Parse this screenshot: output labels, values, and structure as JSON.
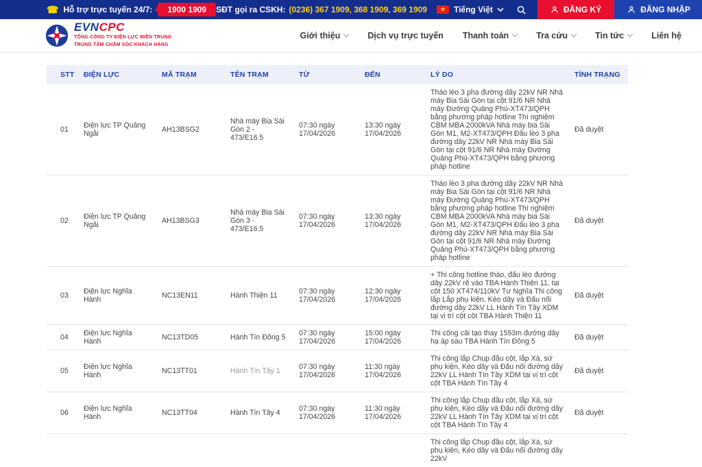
{
  "topbar": {
    "support_label": "Hỗ trợ trực tuyến 24/7:",
    "hotline_badge": "1900 1909",
    "cskh_label": "SĐT gọi ra CSKH:",
    "cskh_numbers": "(0236) 367 1909, 368 1909, 369 1909",
    "language": "Tiếng Việt",
    "register_label": "ĐĂNG KÝ",
    "login_label": "ĐĂNG NHẬP"
  },
  "header": {
    "logo_text_evn": "EVN",
    "logo_text_cpc": "CPC",
    "logo_sub1": "TỔNG CÔNG TY ĐIỆN LỰC MIỀN TRUNG",
    "logo_sub2": "TRUNG TÂM CHĂM SÓC KHÁCH HÀNG",
    "nav": [
      {
        "label": "Giới thiệu",
        "has_dropdown": true
      },
      {
        "label": "Dịch vụ trực tuyến",
        "has_dropdown": false
      },
      {
        "label": "Thanh toán",
        "has_dropdown": true
      },
      {
        "label": "Tra cứu",
        "has_dropdown": true
      },
      {
        "label": "Tin tức",
        "has_dropdown": true
      },
      {
        "label": "Liên hệ",
        "has_dropdown": false
      }
    ]
  },
  "icons": {
    "phone": "phone-icon",
    "flag": "vietnam-flag-icon",
    "search": "search-icon",
    "user": "user-icon",
    "chevron": "chevron-down-icon",
    "logo": "evn-star-logo"
  },
  "colors": {
    "bar_navy": "#142e8e",
    "login_blue": "#1e42ae",
    "accent_red": "#e8102e",
    "accent_yellow": "#ffd400",
    "table_header_text": "#1f41ad",
    "table_header_bg": "#edf0f8"
  },
  "table": {
    "headers": [
      "STT",
      "ĐIỆN LỰC",
      "MÃ TRẠM",
      "TÊN TRẠM",
      "TỪ",
      "ĐẾN",
      "LÝ DO",
      "TÌNH TRẠNG"
    ],
    "rows": [
      {
        "stt": "01",
        "dien_luc": "Điện lực TP Quảng Ngãi",
        "ma_tram": "AH13BSG2",
        "ten_tram": "Nhà máy Bia Sài Gòn 2 - 473/E16.5",
        "tu": "07:30 ngày\n17/04/2026",
        "den": "13:30 ngày\n17/04/2026",
        "ly_do": "Tháo lèo 3 pha đường dây 22kV NR Nhà máy Bia Sài Gòn tại cột 91/6 NR Nhà máy Đường Quảng Phú-XT473/QPH bằng phương pháp hotline Thí nghiệm CBM MBA 2000kVA Nhà máy bia Sài Gòn M1, M2-XT473/QPH Đấu lèo 3 pha đường dây 22kV NR Nhà máy Bia Sài Gòn tại cột 91/6 NR Nhà máy Đường Quảng Phú-XT473/QPH bằng phương pháp hotline",
        "tinh_trang": "Đã duyệt"
      },
      {
        "stt": "02",
        "dien_luc": "Điện lực TP Quảng Ngãi",
        "ma_tram": "AH13BSG3",
        "ten_tram": "Nhà máy Bia Sài Gòn 3 - 473/E16.5",
        "tu": "07:30 ngày\n17/04/2026",
        "den": "13:30 ngày\n17/04/2026",
        "ly_do": "Tháo lèo 3 pha đường dây 22kV NR Nhà máy Bia Sài Gòn tại cột 91/6 NR Nhà máy Đường Quảng Phú-XT473/QPH bằng phương pháp hotline Thí nghiệm CBM MBA 2000kVA Nhà máy bia Sài Gòn M1, M2-XT473/QPH Đấu lèo 3 pha đường dây 22kV NR Nhà máy Bia Sài Gòn tại cột 91/6 NR Nhà máy Đường Quảng Phú-XT473/QPH bằng phương pháp hotline",
        "tinh_trang": "Đã duyệt"
      },
      {
        "stt": "03",
        "dien_luc": "Điện lực Nghĩa Hành",
        "ma_tram": "NC13EN11",
        "ten_tram": "Hành Thiện 11",
        "tu": "07:30 ngày\n17/04/2026",
        "den": "12:30 ngày\n17/04/2026",
        "ly_do": "+ Thi công hotline tháo, đấu lèo đường dây 22kV rẽ vào TBA Hành Thiện 11, tại cột 150 XT474/110kV Tư Nghĩa Thi công lắp Lắp phụ kiện, Kéo dây và Đấu nối đường dây 22kV LL Hành Tín Tây XDM tại vị trí cột cột TBA Hành Thiện 11",
        "tinh_trang": "Đã duyệt"
      },
      {
        "stt": "04",
        "dien_luc": "Điện lực Nghĩa Hành",
        "ma_tram": "NC13TD05",
        "ten_tram": "Hành Tín Đông 5",
        "tu": "07:30 ngày\n17/04/2026",
        "den": "15:00 ngày\n17/04/2026",
        "ly_do": "Thi công cải tạo thay 1553m đường dây hạ áp sau TBA Hành Tín Đông 5",
        "tinh_trang": "Đã duyệt"
      },
      {
        "stt": "05",
        "dien_luc": "Điện lực Nghĩa Hành",
        "ma_tram": "NC13TT01",
        "ten_tram": "Hành Tín Tây 1",
        "faded": true,
        "tu": "07:30 ngày\n17/04/2026",
        "den": "11:30 ngày\n17/04/2026",
        "ly_do": "Thi công lắp Chụp đầu cột, lắp Xà, sứ phụ kiện, Kéo dây và Đấu nối đường dây 22kV LL Hành Tín Tây XDM tại vị trí cột cột TBA Hành Tín Tây 4",
        "tinh_trang": "Đã duyệt"
      },
      {
        "stt": "06",
        "dien_luc": "Điện lực Nghĩa Hành",
        "ma_tram": "NC13TT04",
        "ten_tram": "Hành Tín Tây 4",
        "tu": "07:30 ngày\n17/04/2026",
        "den": "11:30 ngày\n17/04/2026",
        "ly_do": "Thi công lắp Chụp đầu cột, lắp Xà, sứ phụ kiện, Kéo dây và Đấu nối đường dây 22kV LL Hành Tín Tây XDM tại vị trí cột cột TBA Hành Tín Tây 4",
        "tinh_trang": "Đã duyệt"
      },
      {
        "stt": "",
        "dien_luc": "",
        "ma_tram": "",
        "ten_tram": "",
        "tu": "",
        "den": "",
        "ly_do": "Thi công lắp Chụp đầu cột, lắp Xà, sứ phụ kiện, Kéo dây và Đấu nối đường dây 22kV",
        "tinh_trang": "",
        "partial": true
      }
    ]
  }
}
